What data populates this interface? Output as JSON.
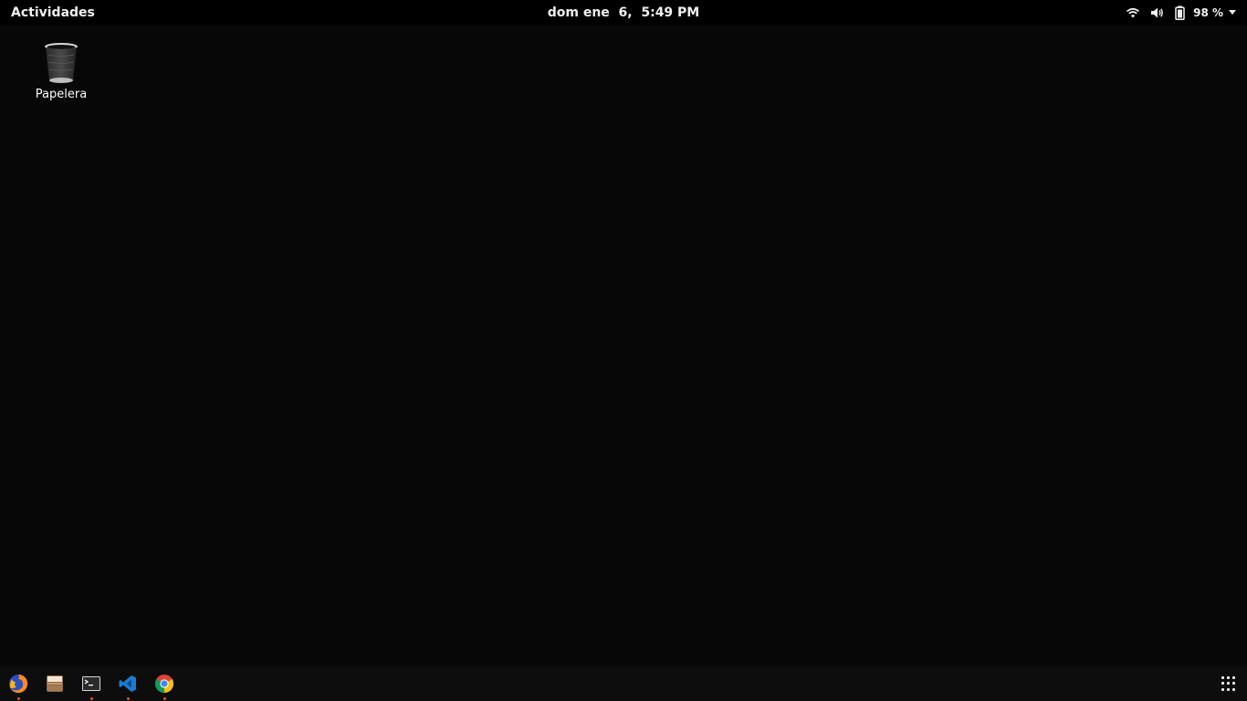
{
  "topbar": {
    "activities_label": "Actividades",
    "clock": "dom ene  6,  5:49 PM",
    "battery_percent": "98 %"
  },
  "desktop": {
    "icons": [
      {
        "label": "Papelera",
        "icon": "trash-icon"
      }
    ]
  },
  "dock": {
    "apps": [
      {
        "name": "firefox",
        "icon": "firefox-icon",
        "running": true
      },
      {
        "name": "files",
        "icon": "files-icon",
        "running": false
      },
      {
        "name": "terminal",
        "icon": "terminal-icon",
        "running": true
      },
      {
        "name": "vscode",
        "icon": "vscode-icon",
        "running": true
      },
      {
        "name": "chrome",
        "icon": "chrome-icon",
        "running": true
      }
    ],
    "show_apps_icon": "grid-icon"
  },
  "colors": {
    "background": "#070707",
    "topbar": "#000000",
    "dock": "#0d0d0d",
    "running_indicator": "#e95420"
  }
}
